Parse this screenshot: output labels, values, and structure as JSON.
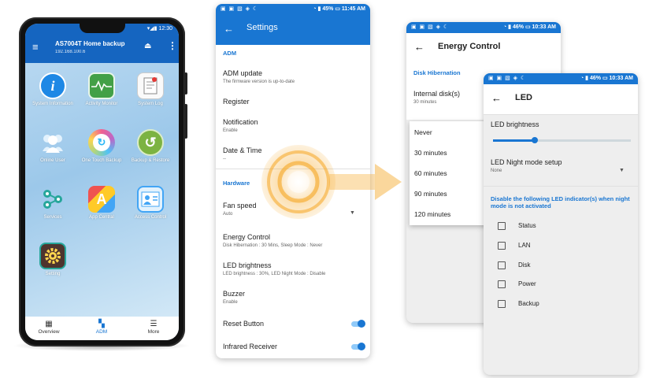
{
  "phone": {
    "status_time": "12:30",
    "app_title": "AS7004T Home backup",
    "ip": "192.168.100.6",
    "apps": [
      {
        "label": "System Information",
        "icon": "info-icon",
        "color": "#1e88e5"
      },
      {
        "label": "Activity Monitor",
        "icon": "activity-monitor-icon",
        "color": "#43a047"
      },
      {
        "label": "System Log",
        "icon": "system-log-icon",
        "color": "#fafafa"
      },
      {
        "label": "Online User",
        "icon": "online-user-icon",
        "color": "#90caf9"
      },
      {
        "label": "One Touch Backup",
        "icon": "one-touch-backup-icon",
        "color": "#ab47bc"
      },
      {
        "label": "Backup & Restore",
        "icon": "backup-restore-icon",
        "color": "#7cb342"
      },
      {
        "label": "Services",
        "icon": "services-icon",
        "color": "#26a69a"
      },
      {
        "label": "App Central",
        "icon": "app-central-icon",
        "color": "#ef5350"
      },
      {
        "label": "Access Control",
        "icon": "access-control-icon",
        "color": "#42a5f5"
      },
      {
        "label": "Setting",
        "icon": "setting-icon",
        "color": "#4e342e"
      }
    ],
    "nav": [
      {
        "label": "Overview",
        "icon": "overview-icon"
      },
      {
        "label": "ADM",
        "icon": "adm-icon"
      },
      {
        "label": "More",
        "icon": "more-icon"
      }
    ]
  },
  "settings": {
    "status_battery": "45%",
    "status_time": "11:45 AM",
    "title": "Settings",
    "sections": {
      "adm": "ADM",
      "hardware": "Hardware"
    },
    "items": {
      "adm_update": {
        "title": "ADM update",
        "sub": "The firmware version is up-to-date"
      },
      "register": {
        "title": "Register"
      },
      "notification": {
        "title": "Notification",
        "sub": "Enable"
      },
      "datetime": {
        "title": "Date & Time",
        "sub": "--"
      },
      "fan": {
        "title": "Fan speed",
        "sub": "Auto"
      },
      "energy": {
        "title": "Energy Control",
        "sub": "Disk Hibernation : 30 Mins, Sleep Mode : Never"
      },
      "led": {
        "title": "LED brightness",
        "sub": "LED brightness : 30%, LED Night Mode : Disable"
      },
      "buzzer": {
        "title": "Buzzer",
        "sub": "Enable"
      },
      "reset": {
        "title": "Reset Button",
        "on": true
      },
      "infrared": {
        "title": "Infrared Receiver",
        "on": true
      }
    }
  },
  "energy": {
    "status_battery": "46%",
    "status_time": "10:33 AM",
    "title": "Energy Control",
    "section": "Disk Hibernation",
    "internal_title": "Internal disk(s)",
    "internal_sub": "30 minutes",
    "options": [
      "Never",
      "30 minutes",
      "60 minutes",
      "90 minutes",
      "120 minutes"
    ]
  },
  "led": {
    "status_battery": "46%",
    "status_time": "10:33 AM",
    "title": "LED",
    "brightness_label": "LED brightness",
    "brightness_fraction": 0.3,
    "night_title": "LED Night mode setup",
    "night_value": "None",
    "disable_label": "Disable the following LED indicator(s) when night mode is not activated",
    "indicators": [
      "Status",
      "LAN",
      "Disk",
      "Power",
      "Backup"
    ]
  },
  "colors": {
    "accent": "#1976d2",
    "highlight": "#f5a623"
  }
}
